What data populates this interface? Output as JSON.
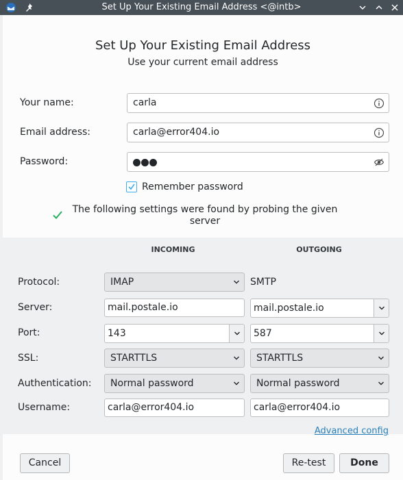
{
  "window": {
    "title": "Set Up Your Existing Email Address <@intb>",
    "accent": "#475057"
  },
  "header": {
    "title": "Set Up Your Existing Email Address",
    "subtitle": "Use your current email address"
  },
  "form": {
    "name_label": "Your name:",
    "name_value": "carla",
    "email_label": "Email address:",
    "email_value": "carla@error404.io",
    "password_label": "Password:",
    "password_masked_length": 3,
    "remember_label": "Remember password",
    "remember_checked": true
  },
  "probe": {
    "message": "The following settings were found by probing the given server"
  },
  "settings": {
    "incoming_header": "INCOMING",
    "outgoing_header": "OUTGOING",
    "labels": {
      "protocol": "Protocol:",
      "server": "Server:",
      "port": "Port:",
      "ssl": "SSL:",
      "authentication": "Authentication:",
      "username": "Username:"
    },
    "incoming": {
      "protocol": "IMAP",
      "server": "mail.postale.io",
      "port": "143",
      "ssl": "STARTTLS",
      "authentication": "Normal password",
      "username": "carla@error404.io"
    },
    "outgoing": {
      "protocol": "SMTP",
      "server": "mail.postale.io",
      "port": "587",
      "ssl": "STARTTLS",
      "authentication": "Normal password",
      "username": "carla@error404.io"
    },
    "advanced_link": "Advanced config"
  },
  "footer": {
    "cancel_label": "Cancel",
    "retest_label": "Re-test",
    "done_label": "Done"
  }
}
